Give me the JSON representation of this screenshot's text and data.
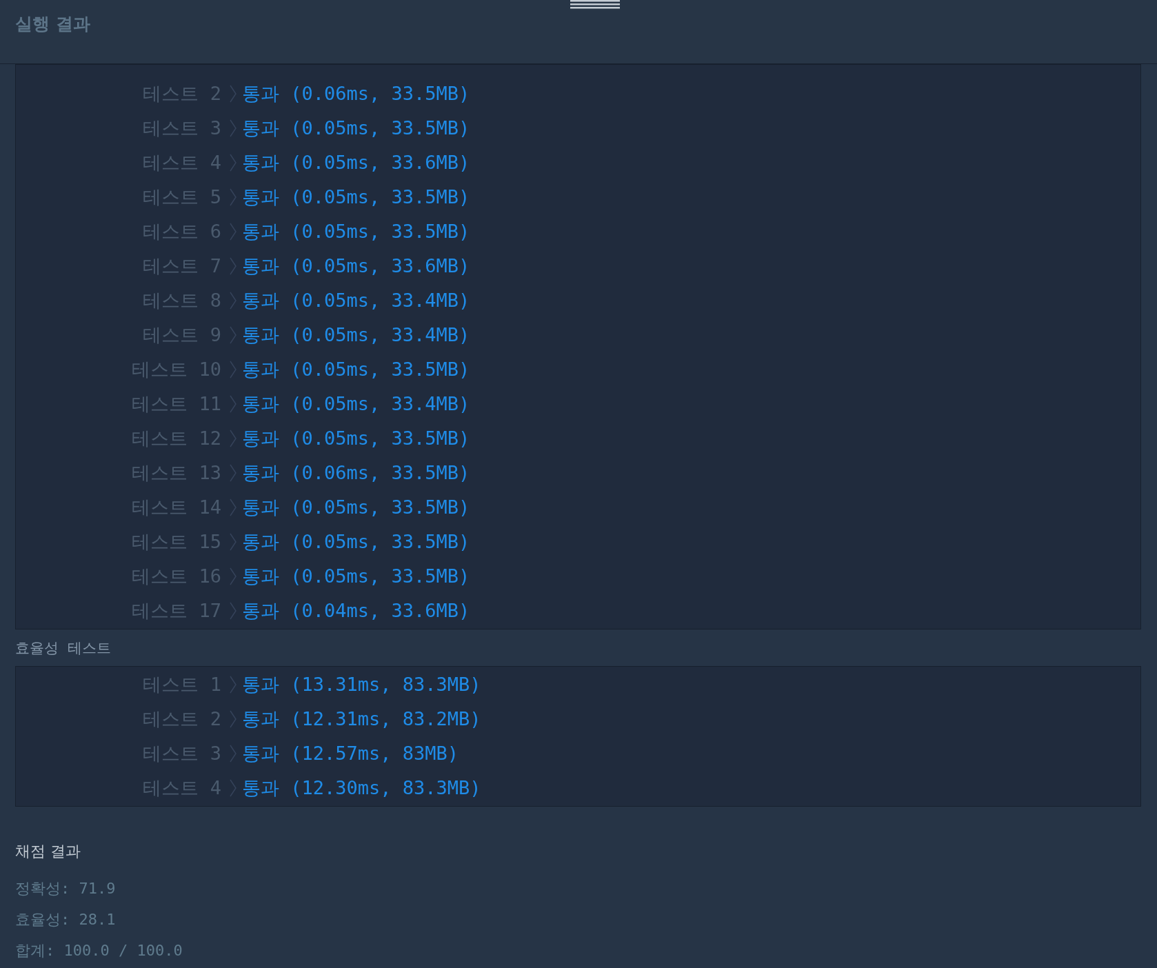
{
  "header": {
    "title": "실행 결과"
  },
  "accuracy_tests": [
    {
      "label": "테스트 2",
      "result": "통과 (0.06ms, 33.5MB)"
    },
    {
      "label": "테스트 3",
      "result": "통과 (0.05ms, 33.5MB)"
    },
    {
      "label": "테스트 4",
      "result": "통과 (0.05ms, 33.6MB)"
    },
    {
      "label": "테스트 5",
      "result": "통과 (0.05ms, 33.5MB)"
    },
    {
      "label": "테스트 6",
      "result": "통과 (0.05ms, 33.5MB)"
    },
    {
      "label": "테스트 7",
      "result": "통과 (0.05ms, 33.6MB)"
    },
    {
      "label": "테스트 8",
      "result": "통과 (0.05ms, 33.4MB)"
    },
    {
      "label": "테스트 9",
      "result": "통과 (0.05ms, 33.4MB)"
    },
    {
      "label": "테스트 10",
      "result": "통과 (0.05ms, 33.5MB)"
    },
    {
      "label": "테스트 11",
      "result": "통과 (0.05ms, 33.4MB)"
    },
    {
      "label": "테스트 12",
      "result": "통과 (0.05ms, 33.5MB)"
    },
    {
      "label": "테스트 13",
      "result": "통과 (0.06ms, 33.5MB)"
    },
    {
      "label": "테스트 14",
      "result": "통과 (0.05ms, 33.5MB)"
    },
    {
      "label": "테스트 15",
      "result": "통과 (0.05ms, 33.5MB)"
    },
    {
      "label": "테스트 16",
      "result": "통과 (0.05ms, 33.5MB)"
    },
    {
      "label": "테스트 17",
      "result": "통과 (0.04ms, 33.6MB)"
    }
  ],
  "efficiency_section": {
    "title": "효율성  테스트"
  },
  "efficiency_tests": [
    {
      "label": "테스트 1",
      "result": "통과 (13.31ms, 83.3MB)"
    },
    {
      "label": "테스트 2",
      "result": "통과 (12.31ms, 83.2MB)"
    },
    {
      "label": "테스트 3",
      "result": "통과 (12.57ms, 83MB)"
    },
    {
      "label": "테스트 4",
      "result": "통과 (12.30ms, 83.3MB)"
    }
  ],
  "grading": {
    "title": "채점 결과",
    "lines": [
      "정확성: 71.9",
      "효율성: 28.1",
      "합계: 100.0 / 100.0"
    ]
  }
}
